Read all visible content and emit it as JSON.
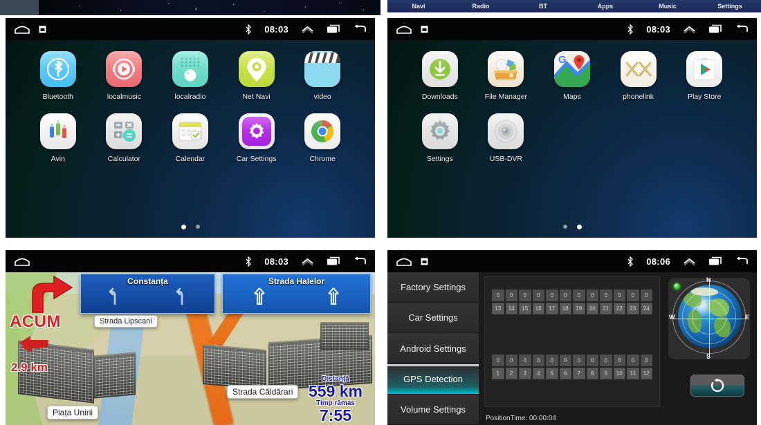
{
  "top_strip": {
    "menu_items": [
      "Navi",
      "Radio",
      "BT",
      "Apps",
      "Music",
      "Settings"
    ]
  },
  "status_bar": {
    "time_panel1": "08:03",
    "time_panel2": "08:03",
    "time_panel3": "08:03",
    "time_panel4": "08:06",
    "icons": [
      "home-icon",
      "screenshot-icon",
      "bluetooth-icon",
      "chevron-up-icon",
      "recents-icon",
      "back-icon"
    ]
  },
  "app_drawer_page1": {
    "page_indicator": {
      "total": 2,
      "active": 1
    },
    "apps": [
      {
        "label": "Bluetooth",
        "icon": "bluetooth-app-icon",
        "color": "#5BC8F5"
      },
      {
        "label": "localmusic",
        "icon": "music-app-icon",
        "color": "#F0757A"
      },
      {
        "label": "localradio",
        "icon": "radio-app-icon",
        "color": "#6EDDCB"
      },
      {
        "label": "Net Navi",
        "icon": "navigation-app-icon",
        "color": "#C8E04A"
      },
      {
        "label": "video",
        "icon": "video-app-icon",
        "color": "#8AD8F0"
      },
      {
        "label": "Avin",
        "icon": "avin-app-icon",
        "color": "#F2F2F2"
      },
      {
        "label": "Calculator",
        "icon": "calculator-app-icon",
        "color": "#C9CCD1"
      },
      {
        "label": "Calendar",
        "icon": "calendar-app-icon",
        "color": "#EFEFEF"
      },
      {
        "label": "Car Settings",
        "icon": "car-settings-app-icon",
        "color": "#B832E8"
      },
      {
        "label": "Chrome",
        "icon": "chrome-app-icon",
        "color": "#FAFAFA"
      }
    ]
  },
  "app_drawer_page2": {
    "page_indicator": {
      "total": 2,
      "active": 2
    },
    "apps": [
      {
        "label": "Downloads",
        "icon": "downloads-app-icon",
        "color": "#8DC63F"
      },
      {
        "label": "File Manager",
        "icon": "file-manager-app-icon",
        "color": "#EDE6DA"
      },
      {
        "label": "Maps",
        "icon": "maps-app-icon",
        "color": "#FFFFFF"
      },
      {
        "label": "phonelink",
        "icon": "phonelink-app-icon",
        "color": "#FDFBF5"
      },
      {
        "label": "Play Store",
        "icon": "play-store-app-icon",
        "color": "#FFFFFF"
      },
      {
        "label": "Settings",
        "icon": "settings-app-icon",
        "color": "#E3E3E3"
      },
      {
        "label": "USB-DVR",
        "icon": "usb-dvr-app-icon",
        "color": "#E6E6E6"
      }
    ]
  },
  "navigation": {
    "maneuver_text": "ACUM",
    "maneuver_distance": "2.9 km",
    "sign_left": {
      "title": "Constanța",
      "arrows": 2,
      "arrow_type": "slight-left"
    },
    "sign_right": {
      "title": "Strada Halelor",
      "arrows": 2,
      "arrow_type": "straight"
    },
    "street_labels": [
      "Strada Lipscani",
      "Piața Unirii",
      "Strada Căldărari"
    ],
    "distance_label": "Distanță",
    "distance_value": "559 km",
    "time_label": "Timp rămas",
    "time_value": "7:55"
  },
  "settings_panel": {
    "sidebar": [
      {
        "label": "Factory Settings",
        "active": false
      },
      {
        "label": "Car Settings",
        "active": false
      },
      {
        "label": "Android Settings",
        "active": false
      },
      {
        "label": "GPS Detection",
        "active": true
      },
      {
        "label": "Volume Settings",
        "active": false
      }
    ],
    "gps": {
      "group_upper": {
        "values": [
          "0",
          "0",
          "0",
          "0",
          "0",
          "0",
          "0",
          "0",
          "0",
          "0",
          "0",
          "0"
        ],
        "indices": [
          "13",
          "14",
          "15",
          "16",
          "17",
          "18",
          "19",
          "20",
          "21",
          "22",
          "23",
          "24"
        ]
      },
      "group_lower": {
        "values": [
          "0",
          "0",
          "0",
          "0",
          "0",
          "0",
          "0",
          "0",
          "0",
          "0",
          "0",
          "0"
        ],
        "indices": [
          "1",
          "2",
          "3",
          "4",
          "5",
          "6",
          "7",
          "8",
          "9",
          "10",
          "11",
          "12"
        ]
      },
      "compass_labels": {
        "north": "N",
        "south": "S",
        "east": "E",
        "west": "W"
      },
      "position_time": "PositionTime: 00:00:04",
      "refresh_icon": "refresh-icon",
      "status_indicator": "gps-status-dot"
    }
  },
  "colors": {
    "accent_teal": "#00b3bf",
    "strip_blue": "#25386b",
    "status_bar": "#050505"
  }
}
